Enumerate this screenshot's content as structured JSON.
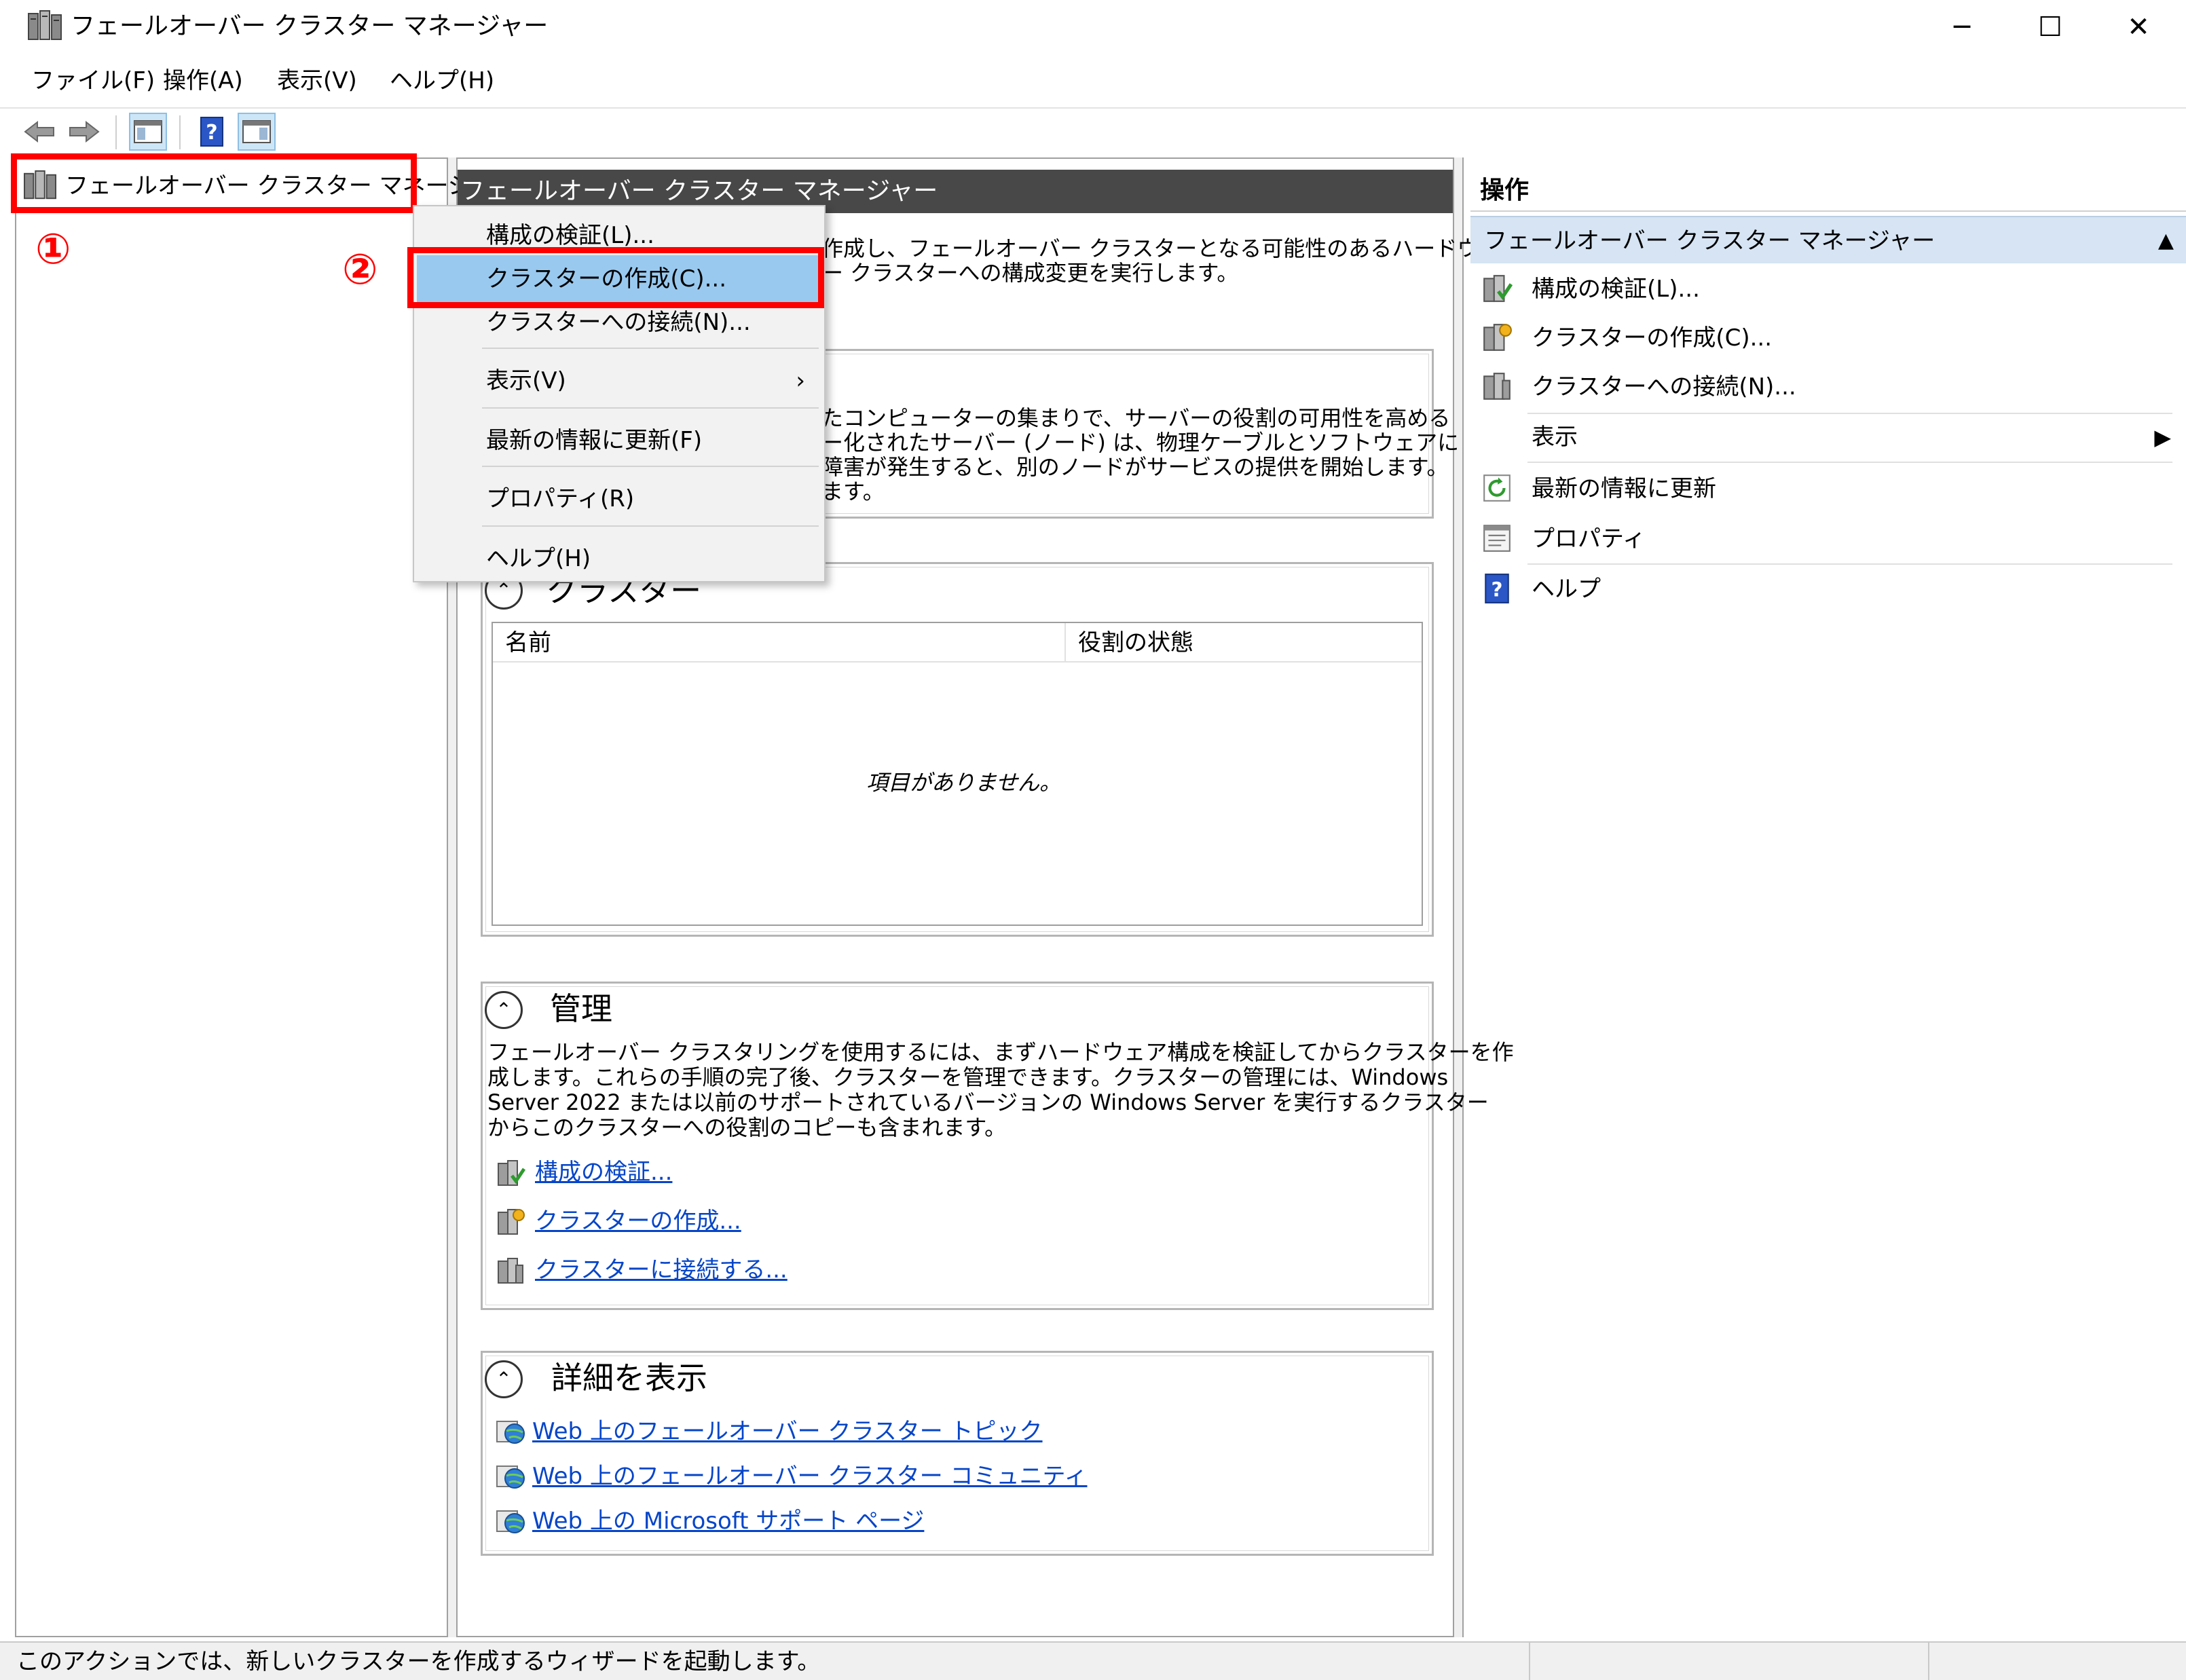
{
  "window": {
    "title": "フェールオーバー クラスター マネージャー",
    "minimize_glyph": "─",
    "maximize_glyph": "☐",
    "close_glyph": "✕"
  },
  "menu": [
    "ファイル(F)",
    "操作(A)",
    "表示(V)",
    "ヘルプ(H)"
  ],
  "toolbar": {
    "icons": [
      "back-arrow-icon",
      "forward-arrow-icon",
      "show-hide-console-tree-icon",
      "help-icon",
      "show-hide-action-pane-icon"
    ]
  },
  "tree": {
    "root_label": "フェールオーバー クラスター マネージャー"
  },
  "annotations": {
    "marker1": "①",
    "marker2": "②",
    "color": "#ff0000"
  },
  "context_menu": {
    "items": [
      {
        "label": "構成の検証(L)..."
      },
      {
        "label": "クラスターの作成(C)...",
        "highlighted": true
      },
      {
        "label": "クラスターへの接続(N)..."
      },
      {
        "label": "表示(V)",
        "has_submenu": true,
        "arrow": "›"
      },
      {
        "label": "最新の情報に更新(F)"
      },
      {
        "label": "プロパティ(R)"
      },
      {
        "label": "ヘルプ(H)"
      }
    ]
  },
  "center": {
    "header": "フェールオーバー クラスター マネージャー",
    "intro_lines": [
      "作成し、フェールオーバー クラスターとなる可能性のあるハードウェ",
      "ー クラスターへの構成変更を実行します。"
    ],
    "overview_lines": [
      "たコンピューターの集まりで、サーバーの役割の可用性を高める",
      "ー化されたサーバー (ノード) は、物理ケーブルとソフトウェアに",
      "障害が発生すると、別のノードがサービスの提供を開始します。",
      "ます。"
    ],
    "clusters": {
      "title": "クラスター",
      "collapse_glyph": "⌃",
      "columns": [
        "名前",
        "役割の状態"
      ],
      "empty_message": "項目がありません。"
    },
    "management": {
      "title": "管理",
      "collapse_glyph": "⌃",
      "lines": [
        "フェールオーバー クラスタリングを使用するには、まずハードウェア構成を検証してからクラスターを作",
        "成します。これらの手順の完了後、クラスターを管理できます。クラスターの管理には、Windows",
        "Server 2022 または以前のサポートされているバージョンの Windows Server を実行するクラスター",
        "からこのクラスターへの役割のコピーも含まれます。"
      ],
      "links": [
        "構成の検証...",
        "クラスターの作成...",
        "クラスターに接続する..."
      ]
    },
    "details": {
      "title": "詳細を表示",
      "collapse_glyph": "⌃",
      "links": [
        "Web 上のフェールオーバー クラスター トピック",
        "Web 上のフェールオーバー クラスター コミュニティ",
        "Web 上の Microsoft サポート ページ"
      ]
    }
  },
  "actions": {
    "header": "操作",
    "section": "フェールオーバー クラスター マネージャー",
    "section_collapse": "▲",
    "items": [
      {
        "label": "構成の検証(L)...",
        "icon": "validate-configuration-icon"
      },
      {
        "label": "クラスターの作成(C)...",
        "icon": "create-cluster-icon"
      },
      {
        "label": "クラスターへの接続(N)...",
        "icon": "connect-cluster-icon"
      },
      {
        "label": "表示",
        "icon": "",
        "arrow": "▶"
      },
      {
        "label": "最新の情報に更新",
        "icon": "refresh-icon"
      },
      {
        "label": "プロパティ",
        "icon": "properties-icon"
      },
      {
        "label": "ヘルプ",
        "icon": "help-icon"
      }
    ]
  },
  "status": {
    "text": "このアクションでは、新しいクラスターを作成するウィザードを起動します。"
  }
}
